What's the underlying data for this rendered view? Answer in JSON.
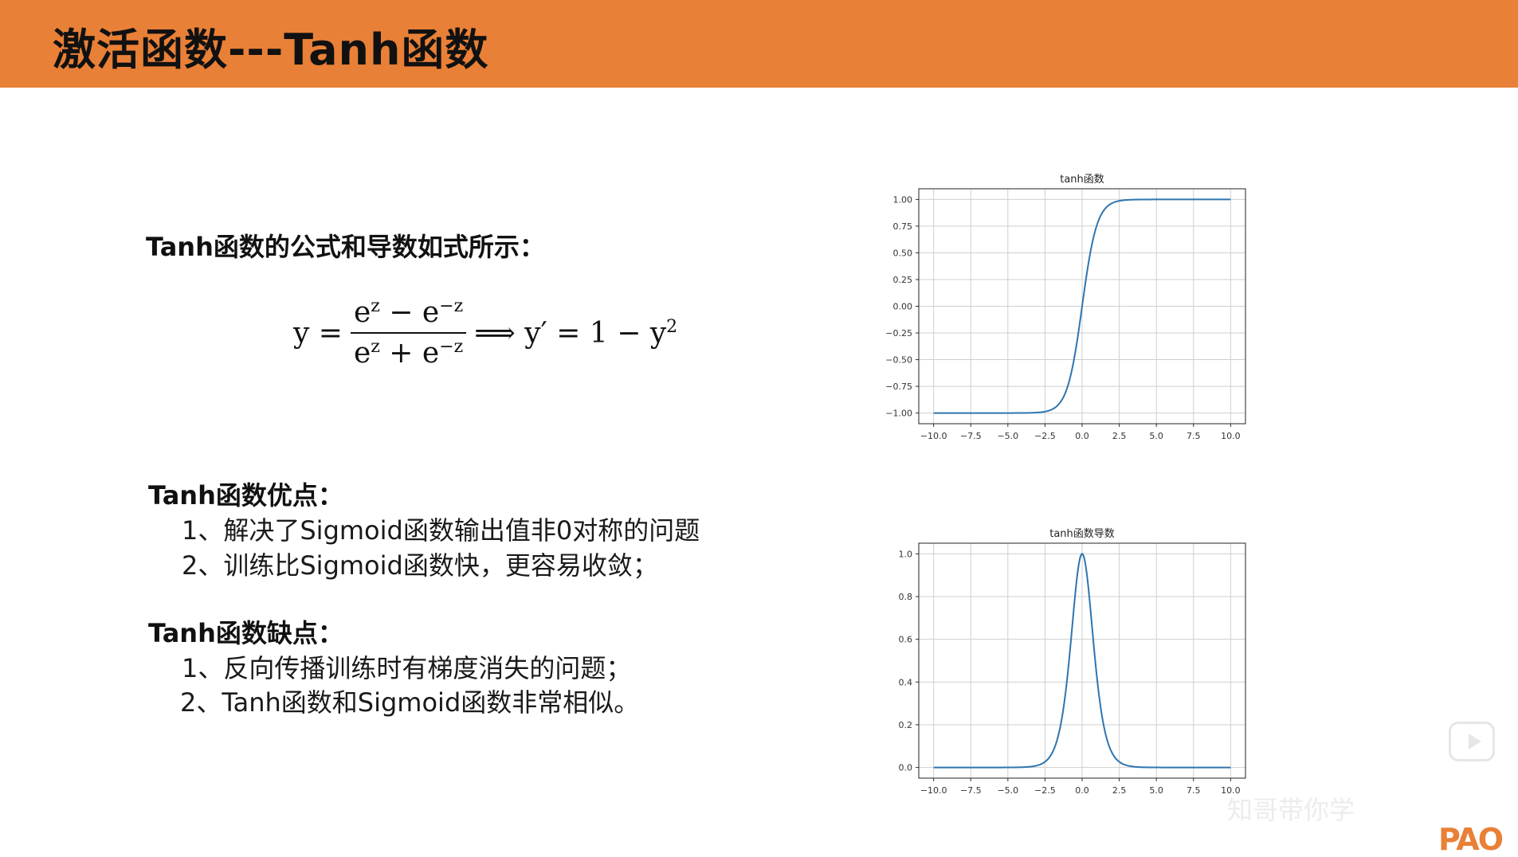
{
  "header": {
    "title": "激活函数---Tanh函数"
  },
  "intro": "Tanh函数的公式和导数如式所示：",
  "formula": {
    "lhs": "y =",
    "numerator": "e",
    "numerator_exp1": "z",
    "numerator_op": " − e",
    "numerator_exp2": "−z",
    "denominator": "e",
    "denominator_exp1": "z",
    "denominator_op": " + e",
    "denominator_exp2": "−z",
    "rhs": "⟹ y′ = 1 − y",
    "rhs_exp": "2"
  },
  "pros": {
    "title": "Tanh函数优点：",
    "items": [
      "1、解决了Sigmoid函数输出值非0对称的问题",
      "2、训练比Sigmoid函数快，更容易收敛；"
    ]
  },
  "cons": {
    "title": "Tanh函数缺点：",
    "items": [
      "1、反向传播训练时有梯度消失的问题；",
      "2、Tanh函数和Sigmoid函数非常相似。"
    ]
  },
  "watermark": "知哥带你学",
  "brand": "PAO",
  "icons": {
    "play": "play-button-icon"
  },
  "chart_data": [
    {
      "type": "line",
      "title": "tanh函数",
      "function": "tanh",
      "x_range": [
        -10,
        10
      ],
      "xlim": [
        -10,
        10
      ],
      "ylim": [
        -1,
        1
      ],
      "x_ticks": [
        -10.0,
        -7.5,
        -5.0,
        -2.5,
        0.0,
        2.5,
        5.0,
        7.5,
        10.0
      ],
      "x_tick_labels": [
        "−10.0",
        "−7.5",
        "−5.0",
        "−2.5",
        "0.0",
        "2.5",
        "5.0",
        "7.5",
        "10.0"
      ],
      "y_ticks": [
        -1.0,
        -0.75,
        -0.5,
        -0.25,
        0.0,
        0.25,
        0.5,
        0.75,
        1.0
      ],
      "y_tick_labels": [
        "−1.00",
        "−0.75",
        "−0.50",
        "−0.25",
        "0.00",
        "0.25",
        "0.50",
        "0.75",
        "1.00"
      ],
      "x": [
        -10,
        -7.5,
        -5,
        -2.5,
        -2,
        -1.5,
        -1,
        -0.5,
        0,
        0.5,
        1,
        1.5,
        2,
        2.5,
        5,
        7.5,
        10
      ],
      "y": [
        -1.0,
        -1.0,
        -0.9999,
        -0.9866,
        -0.964,
        -0.9051,
        -0.7616,
        -0.4621,
        0.0,
        0.4621,
        0.7616,
        0.9051,
        0.964,
        0.9866,
        0.9999,
        1.0,
        1.0
      ],
      "grid": true,
      "line_color": "#2e75b0"
    },
    {
      "type": "line",
      "title": "tanh函数导数",
      "function": "1 - tanh^2",
      "x_range": [
        -10,
        10
      ],
      "xlim": [
        -10,
        10
      ],
      "ylim": [
        0,
        1
      ],
      "x_ticks": [
        -10.0,
        -7.5,
        -5.0,
        -2.5,
        0.0,
        2.5,
        5.0,
        7.5,
        10.0
      ],
      "x_tick_labels": [
        "−10.0",
        "−7.5",
        "−5.0",
        "−2.5",
        "0.0",
        "2.5",
        "5.0",
        "7.5",
        "10.0"
      ],
      "y_ticks": [
        0.0,
        0.2,
        0.4,
        0.6,
        0.8,
        1.0
      ],
      "y_tick_labels": [
        "0.0",
        "0.2",
        "0.4",
        "0.6",
        "0.8",
        "1.0"
      ],
      "x": [
        -10,
        -7.5,
        -5,
        -2.5,
        -2,
        -1.5,
        -1,
        -0.5,
        0,
        0.5,
        1,
        1.5,
        2,
        2.5,
        5,
        7.5,
        10
      ],
      "y": [
        0.0,
        0.0,
        0.0002,
        0.0266,
        0.0707,
        0.1807,
        0.42,
        0.7864,
        1.0,
        0.7864,
        0.42,
        0.1807,
        0.0707,
        0.0266,
        0.0002,
        0.0,
        0.0
      ],
      "grid": true,
      "line_color": "#2e75b0"
    }
  ]
}
